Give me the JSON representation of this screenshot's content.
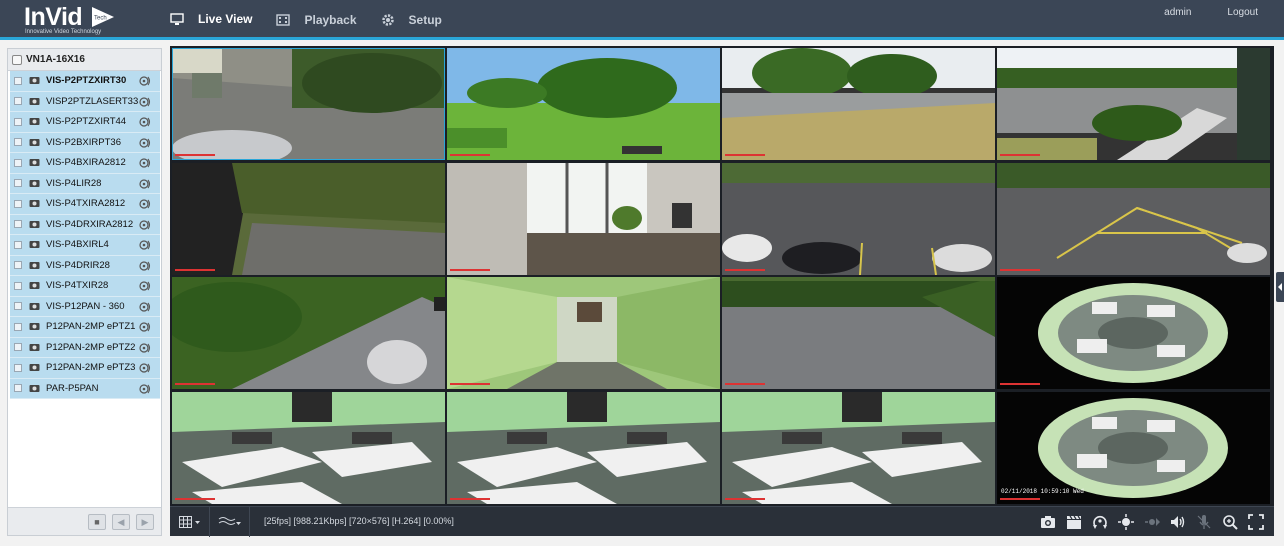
{
  "brand": {
    "logo": "InVid",
    "tagline": "Innovative Video Technology",
    "mark": "Tech"
  },
  "nav": [
    {
      "label": "Live View",
      "active": true,
      "icon": "monitor-icon"
    },
    {
      "label": "Playback",
      "active": false,
      "icon": "film-icon"
    },
    {
      "label": "Setup",
      "active": false,
      "icon": "gear-icon"
    }
  ],
  "header_right": {
    "user": "admin",
    "logout": "Logout"
  },
  "sidebar": {
    "device": "VN1A-16X16",
    "cameras": [
      {
        "name": "VIS-P2PTZXIRT30",
        "bold": true
      },
      {
        "name": "VISP2PTZLASERT33",
        "bold": false
      },
      {
        "name": "VIS-P2PTZXIRT44",
        "bold": false
      },
      {
        "name": "VIS-P2BXIRPT36",
        "bold": false
      },
      {
        "name": "VIS-P4BXIRA2812",
        "bold": false
      },
      {
        "name": "VIS-P4LIR28",
        "bold": false
      },
      {
        "name": "VIS-P4TXIRA2812",
        "bold": false
      },
      {
        "name": "VIS-P4DRXIRA2812",
        "bold": false
      },
      {
        "name": "VIS-P4BXIRL4",
        "bold": false
      },
      {
        "name": "VIS-P4DRIR28",
        "bold": false
      },
      {
        "name": "VIS-P4TXIR28",
        "bold": false
      },
      {
        "name": "VIS-P12PAN - 360",
        "bold": false
      },
      {
        "name": "P12PAN-2MP ePTZ1",
        "bold": false
      },
      {
        "name": "P12PAN-2MP ePTZ2",
        "bold": false
      },
      {
        "name": "P12PAN-2MP ePTZ3",
        "bold": false
      },
      {
        "name": "PAR-P5PAN",
        "bold": false
      }
    ]
  },
  "tiles": [
    {
      "scene": "driveway-dumpster",
      "osd": ""
    },
    {
      "scene": "lawn-trees",
      "osd": ""
    },
    {
      "scene": "field-trees",
      "osd": ""
    },
    {
      "scene": "road-bushes",
      "osd": ""
    },
    {
      "scene": "wall-grass",
      "osd": ""
    },
    {
      "scene": "lobby-door",
      "osd": ""
    },
    {
      "scene": "parking-lot",
      "osd": ""
    },
    {
      "scene": "parking-lines",
      "osd": ""
    },
    {
      "scene": "road-car",
      "osd": ""
    },
    {
      "scene": "hallway",
      "osd": ""
    },
    {
      "scene": "road-wide",
      "osd": ""
    },
    {
      "scene": "fisheye",
      "osd": ""
    },
    {
      "scene": "office",
      "osd": ""
    },
    {
      "scene": "office",
      "osd": ""
    },
    {
      "scene": "office",
      "osd": ""
    },
    {
      "scene": "fisheye",
      "osd": "02/11/2018 10:59:10 Wed"
    }
  ],
  "toolbar": {
    "status": "[25fps] [988.21Kbps] [720×576] [H.264] [0.00%]",
    "right_icons": [
      "camera-snapshot-icon",
      "clapper-record-icon",
      "ptz-icon",
      "focus-icon",
      "audio-out-icon",
      "volume-icon",
      "mic-icon",
      "zoom-icon",
      "fullscreen-icon"
    ]
  },
  "colors": {
    "header": "#3b4656",
    "accent": "#2aa6d8",
    "list_bg": "#b9dcef",
    "toolbar": "#2a3039"
  }
}
